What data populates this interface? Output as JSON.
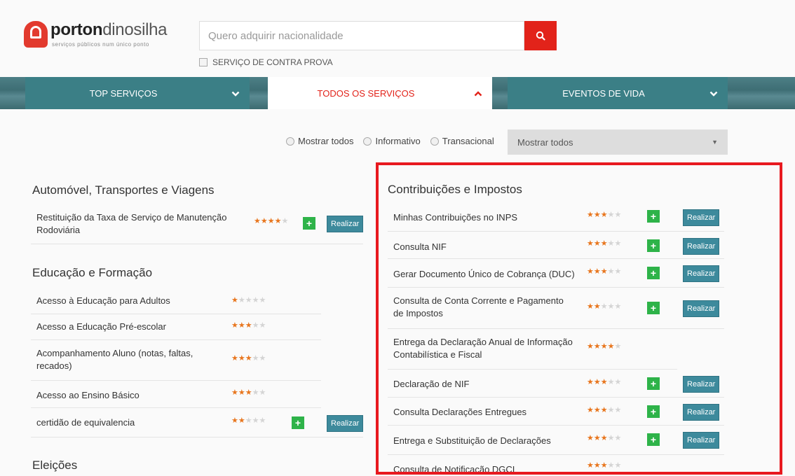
{
  "brand": {
    "name_bold": "porton",
    "name_light": "dinosilha",
    "tagline": "serviços públicos num único ponto"
  },
  "search": {
    "placeholder": "Quero adquirir nacionalidade",
    "contra_prova": "SERVIÇO DE CONTRA PROVA"
  },
  "nav": {
    "tabs": [
      {
        "label": "TOP SERVIÇOS"
      },
      {
        "label": "TODOS OS SERVIÇOS"
      },
      {
        "label": "EVENTOS DE VIDA"
      }
    ]
  },
  "filters": {
    "radios": [
      "Mostrar todos",
      "Informativo",
      "Transacional"
    ],
    "select_value": "Mostrar todos"
  },
  "realizar_label": "Realizar",
  "left": {
    "categories": [
      {
        "title": "Automóvel, Transportes e Viagens",
        "items": [
          {
            "name": "Restituição da Taxa de Serviço de Manutenção Rodoviária",
            "rating": 4,
            "actions": true
          }
        ]
      },
      {
        "title": "Educação e Formação",
        "items": [
          {
            "name": "Acesso à Educação para Adultos",
            "rating": 1,
            "actions": false
          },
          {
            "name": "Acesso a Educação Pré-escolar",
            "rating": 3,
            "actions": false
          },
          {
            "name": "Acompanhamento Aluno (notas, faltas, recados)",
            "rating": 3,
            "actions": false
          },
          {
            "name": "Acesso ao Ensino Básico",
            "rating": 3,
            "actions": false
          },
          {
            "name": "certidão de equivalencia",
            "rating": 2,
            "actions": true
          }
        ]
      },
      {
        "title": "Eleições",
        "items": []
      }
    ]
  },
  "right": {
    "title": "Contribuições e Impostos",
    "items": [
      {
        "name": "Minhas Contribuições no INPS",
        "rating": 3,
        "actions": true
      },
      {
        "name": "Consulta NIF",
        "rating": 3,
        "actions": true
      },
      {
        "name": "Gerar Documento Único de Cobrança (DUC)",
        "rating": 3,
        "actions": true
      },
      {
        "name": "Consulta de Conta Corrente e Pagamento de Impostos",
        "rating": 2,
        "actions": true
      },
      {
        "name": "Entrega da Declaração Anual de Informação Contabilística e Fiscal",
        "rating": 4,
        "actions": false
      },
      {
        "name": "Declaração de NIF",
        "rating": 3,
        "actions": true
      },
      {
        "name": "Consulta Declarações Entregues",
        "rating": 3,
        "actions": true
      },
      {
        "name": "Entrega e Substituição de Declarações",
        "rating": 3,
        "actions": true
      },
      {
        "name": "Consulta de Notificação DGCI",
        "rating": 3,
        "actions": false
      }
    ]
  },
  "colors": {
    "accent_red": "#e2231a",
    "teal": "#3b7f86",
    "star": "#e8761e",
    "plus_green": "#2eb349",
    "highlight": "#e8191f"
  }
}
